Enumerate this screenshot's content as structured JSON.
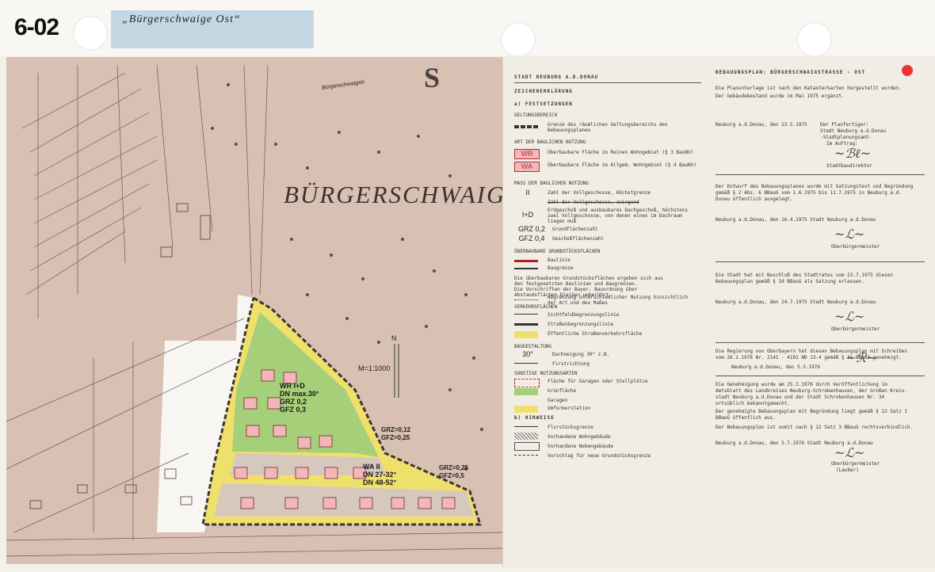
{
  "header": {
    "sheet_code": "6-02",
    "tag_label": "„Bürgerschwaige Ost“"
  },
  "map": {
    "place_name": "BÜRGERSCHWAIGE",
    "street_label": "Bürgerschwaigstr.",
    "scale": "M=1:1000",
    "north": "N",
    "zones": {
      "wr": [
        "WR I+D",
        "DN max.30°",
        "GRZ 0,2",
        "GFZ 0,3"
      ],
      "wa_mid": [
        "GRZ=0,12",
        "GFZ=0,25"
      ],
      "wa_south": [
        "WA II",
        "DN 27-32°",
        "DN 48-52°"
      ],
      "east": [
        "GRZ=0,25",
        "GFZ=0,5"
      ]
    }
  },
  "legend": {
    "city_header": "STADT NEUBURG A.D.DONAU",
    "zeichen_header": "ZEICHENERKLÄRUNG",
    "a_festsetzungen": "a) FESTSETZUNGEN",
    "geltungsbereich": "GELTUNGSBEREICH",
    "grenze": "Grenze des räumlichen Geltungsbereichs des Bebauungsplanes",
    "art": "ART DER BAULICHEN NUTZUNG",
    "wr_sym": "WR",
    "wr_txt": "Überbaubare Fläche im Reinen Wohngebiet (§ 3 BauNV)",
    "wa_sym": "WA",
    "wa_txt": "Überbaubare Fläche im Allgem. Wohngebiet (§ 4 BauNV)",
    "mass": "MASS DER BAULICHEN NUTZUNG",
    "ii_sym": "II",
    "ii_txt": "Zahl der Vollgeschosse, Höchstgrenze",
    "ii_txt2": "Zahl der Vollgeschosse, zwingend",
    "id_sym": "I+D",
    "id_txt": "Erdgeschoß und ausbaubares Dachgeschoß, höchstens zwei Vollgeschosse, von denen eines im Dachraum liegen muß",
    "grz_sym": "GRZ 0,2",
    "grz_txt": "Grundflächenzahl",
    "gfz_sym": "GFZ 0,4",
    "gfz_txt": "Geschoßflächenzahl",
    "ueberbaubar": "ÜBERBAUBARE GRUNDSTÜCKSFLÄCHEN",
    "baulinie": "Baulinie",
    "baugrenze": "Baugrenze",
    "note1": "Die überbaubaren Grundstücksflächen ergeben sich aus den festgesetzten Baulinien und Baugrenzen.",
    "note2": "Die Vorschriften der Bayer. Bauordnung über Abstandsflächen bleiben unberührt.",
    "abgrenzung": "Abgrenzung unterschiedlicher Nutzung hinsichtlich der Art und des Maßes",
    "verkehr": "VERKEHRSFLÄCHEN",
    "sichtfeld": "Sichtfeldbegrenzungslinie",
    "strassenbeg": "Straßenbegrenzungslinie",
    "oeffentlich": "Öffentliche Straßenverkehrsfläche",
    "bauweise": "BAUGESTALTUNG",
    "dach_sym": "30°",
    "dach_txt": "Dachneigung 30° z.B.",
    "first": "Firstrichtung",
    "sonst": "SONSTIGE NUTZUNGSARTEN",
    "garagen_fl": "Fläche für Garagen oder Stellplätze",
    "gruen": "Grünfläche",
    "garagen": "Garagen",
    "trafo": "Umformerstation",
    "b_hinweise": "b) HINWEISE",
    "flur": "Flurstücksgrenze",
    "vorh_wohn": "Vorhandene Wohngebäude",
    "vorh_neben": "Vorhandene Nebengebäude",
    "vorschlag": "Vorschlag für neue Grundstücksgrenze"
  },
  "right": {
    "plan_title": "BEBAUUNGSPLAN: BÜRGERSCHWAIGSTRASSE - OST",
    "p1a": "Die Planunterlage ist nach den Katasterkarten hergestellt worden.",
    "p1b": "Der Gebäudebestand wurde im  Mai 1975  ergänzt.",
    "s1a": "Neuburg a.d.Donau, den  23.5.1975",
    "s1b": "Der Planfertiger:",
    "s1c": "Stadt Neuburg a.d.Donau",
    "s1d": "-Stadtplanungsamt-",
    "s1e": "Im Auftrag:",
    "s1f": "Stadtbaudirektor",
    "p2a": "Der Entwurf des Bebauungsplanes wurde mit Satzungstext und Begründung",
    "p2b": "gemäß § 2 Abs. 6 BBauG vom  1.6.1975  bis  11.7.1975  in Neuburg a.d.",
    "p2c": "Donau öffentlich ausgelegt.",
    "s2a": "Neuburg a.d.Donau, den  16.4.1975  Stadt Neuburg a.d.Donau",
    "s2b": "Oberbürgermeister",
    "p3a": "Die Stadt hat mit Beschluß des Stadtrates vom  23.7.1975  diesen",
    "p3b": "Bebauungsplan gemäß § 10 BBauG als Satzung erlassen.",
    "s3a": "Neuburg a.d.Donau, den  24.7.1975  Stadt Neuburg a.d.Donau",
    "s3b": "Oberbürgermeister",
    "p4a": "Die Regierung von Oberbayern hat diesen Bebauungsplan mit Schreiben",
    "p4b": "vom  26.2.1976   Nr. 2141 - 4101 ND 13-4  gemäß § 11 BBauG genehmigt.",
    "p4c": "Neuburg a.d.Donau, den  5.3.1976",
    "p5a": "Die Genehmigung wurde am  25.3.1976   durch Veröffentlichung im",
    "p5b": "Amtsblatt des Landkreises Neuburg-Schrobenhausen, der Großen Kreis-",
    "p5c": "stadt Neuburg a.d.Donau und der Stadt Schrobenhausen Nr. 34",
    "p5d": "ortsüblich bekanntgemacht.",
    "p5e": "Der genehmigte Bebauungsplan mit Begründung liegt gemäß § 12 Satz 1",
    "p5f": "BBauG öffentlich aus.",
    "p5g": "Der Bebauungsplan ist somit nach § 12 Satz 3 BBauG rechtsverbindlich.",
    "s5a": "Neuburg a.d.Donau, den  5.7.1976   Stadt Neuburg a.d.Donau",
    "s5b": "Oberbürgermeister",
    "s5c": "(Lauber)"
  },
  "colors": {
    "wr_fill": "#f3b6b9",
    "green": "#a6cf79",
    "yellow": "#efe06b",
    "accent_dot": "#ef3434"
  }
}
